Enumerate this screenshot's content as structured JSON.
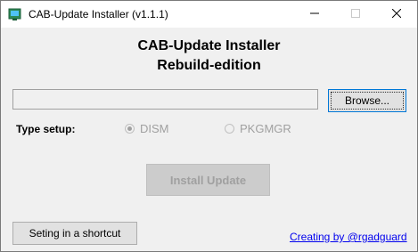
{
  "window": {
    "title": "CAB-Update Installer (v1.1.1)",
    "icon": "app-installer-icon",
    "controls": [
      "minimize-icon",
      "maximize-icon",
      "close-icon"
    ]
  },
  "header": {
    "title": "CAB-Update Installer",
    "subtitle": "Rebuild-edition"
  },
  "file_picker": {
    "value": "",
    "browse_label": "Browse..."
  },
  "setup": {
    "label": "Type setup:",
    "options": [
      {
        "label": "DISM",
        "checked": true,
        "enabled": false
      },
      {
        "label": "PKGMGR",
        "checked": false,
        "enabled": false
      }
    ]
  },
  "install_label": "Install Update",
  "shortcut_label": "Seting in a shortcut",
  "credit_link": "Creating by @rgadguard",
  "colors": {
    "link": "#0000ee",
    "focus_border": "#0078d7",
    "disabled_text": "#a0a0a0"
  }
}
